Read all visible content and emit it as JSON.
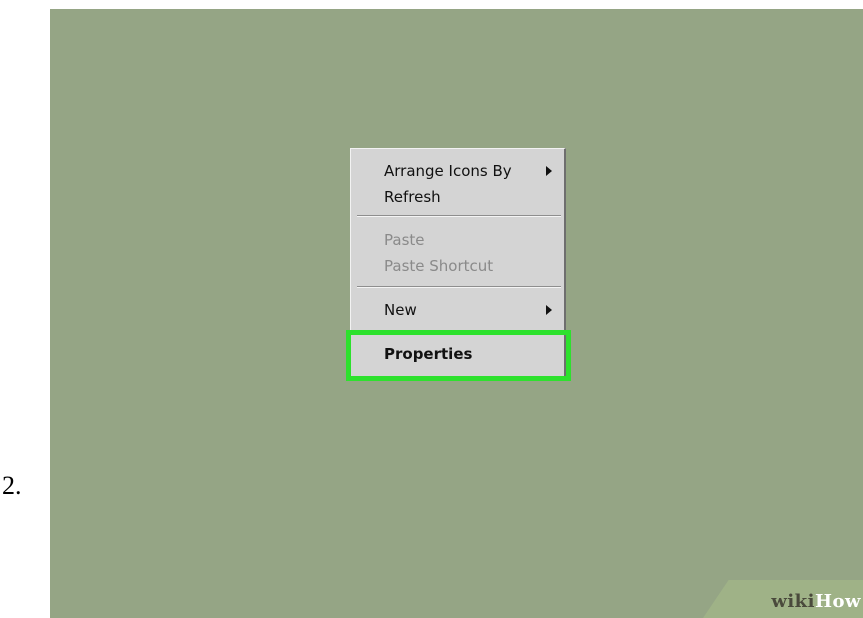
{
  "step_label": "2.",
  "context_menu": {
    "items": [
      {
        "label": "Arrange Icons By",
        "has_submenu": true,
        "enabled": true
      },
      {
        "label": "Refresh",
        "has_submenu": false,
        "enabled": true
      },
      {
        "label": "Paste",
        "has_submenu": false,
        "enabled": false
      },
      {
        "label": "Paste Shortcut",
        "has_submenu": false,
        "enabled": false
      },
      {
        "label": "New",
        "has_submenu": true,
        "enabled": true
      },
      {
        "label": "Properties",
        "has_submenu": false,
        "enabled": true,
        "highlighted": true
      }
    ]
  },
  "watermark": {
    "part1": "wiki",
    "part2": "How"
  },
  "colors": {
    "desktop_background": "#95a585",
    "menu_background": "#d4d4d4",
    "highlight": "#2de12d",
    "disabled_text": "#8a8a8a"
  }
}
